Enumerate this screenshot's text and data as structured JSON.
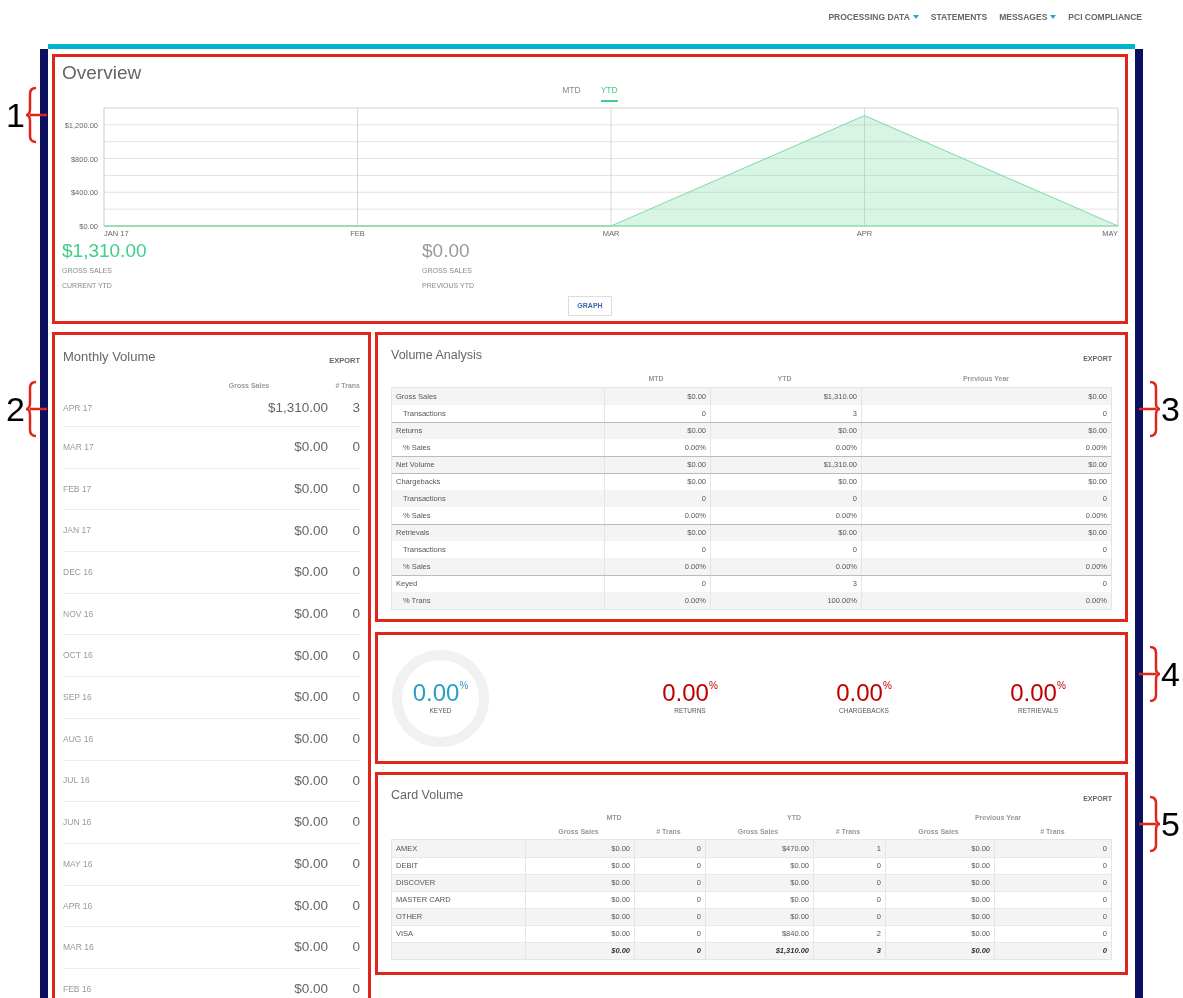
{
  "nav": [
    {
      "label": "PROCESSING DATA",
      "has_menu": true
    },
    {
      "label": "STATEMENTS",
      "has_menu": false
    },
    {
      "label": "MESSAGES",
      "has_menu": true
    },
    {
      "label": "PCI COMPLIANCE",
      "has_menu": false
    }
  ],
  "overview": {
    "title": "Overview",
    "tabs": [
      {
        "label": "MTD",
        "selected": false
      },
      {
        "label": "YTD",
        "selected": true
      }
    ],
    "chart_data": {
      "type": "area",
      "categories": [
        "JAN 17",
        "FEB",
        "MAR",
        "APR",
        "MAY"
      ],
      "series": [
        {
          "color": "#7fd9a6",
          "values": [
            0,
            0,
            0,
            1310,
            0
          ]
        }
      ],
      "grid": true,
      "ylim": [
        0,
        1400
      ],
      "yticks": [
        {
          "value": 0,
          "label": "$0.00"
        },
        {
          "value": 400,
          "label": "$400.00"
        },
        {
          "value": 800,
          "label": "$800.00"
        },
        {
          "value": 1200,
          "label": "$1,200.00"
        }
      ]
    },
    "summaries": [
      {
        "amount": "$1,310.00",
        "label": "GROSS SALES",
        "period": "CURRENT YTD",
        "color": "#3fcf86"
      },
      {
        "amount": "$0.00",
        "label": "GROSS SALES",
        "period": "PREVIOUS YTD",
        "color": "#9a9a9a"
      }
    ],
    "button": "GRAPH"
  },
  "monthly_volume": {
    "title": "Monthly Volume",
    "export": "EXPORT",
    "columns": [
      "Gross Sales",
      "# Trans"
    ],
    "rows": [
      {
        "month": "APR 17",
        "gross_sales": "$1,310.00",
        "trans": "3"
      },
      {
        "month": "MAR 17",
        "gross_sales": "$0.00",
        "trans": "0"
      },
      {
        "month": "FEB 17",
        "gross_sales": "$0.00",
        "trans": "0"
      },
      {
        "month": "JAN 17",
        "gross_sales": "$0.00",
        "trans": "0"
      },
      {
        "month": "DEC 16",
        "gross_sales": "$0.00",
        "trans": "0"
      },
      {
        "month": "NOV 16",
        "gross_sales": "$0.00",
        "trans": "0"
      },
      {
        "month": "OCT 16",
        "gross_sales": "$0.00",
        "trans": "0"
      },
      {
        "month": "SEP 16",
        "gross_sales": "$0.00",
        "trans": "0"
      },
      {
        "month": "AUG 16",
        "gross_sales": "$0.00",
        "trans": "0"
      },
      {
        "month": "JUL 16",
        "gross_sales": "$0.00",
        "trans": "0"
      },
      {
        "month": "JUN 16",
        "gross_sales": "$0.00",
        "trans": "0"
      },
      {
        "month": "MAY 16",
        "gross_sales": "$0.00",
        "trans": "0"
      },
      {
        "month": "APR 16",
        "gross_sales": "$0.00",
        "trans": "0"
      },
      {
        "month": "MAR 16",
        "gross_sales": "$0.00",
        "trans": "0"
      },
      {
        "month": "FEB 16",
        "gross_sales": "$0.00",
        "trans": "0"
      }
    ]
  },
  "volume_analysis": {
    "title": "Volume Analysis",
    "export": "EXPORT",
    "columns": [
      "MTD",
      "YTD",
      "Previous Year"
    ],
    "rows": [
      {
        "kind": "main",
        "label": "Gross Sales",
        "values": [
          "$0.00",
          "$1,310.00",
          "$0.00"
        ]
      },
      {
        "kind": "sub",
        "label": "Transactions",
        "values": [
          "0",
          "3",
          "0"
        ]
      },
      {
        "kind": "main",
        "label": "Returns",
        "values": [
          "$0.00",
          "$0.00",
          "$0.00"
        ]
      },
      {
        "kind": "sub",
        "label": "% Sales",
        "values": [
          "0.00%",
          "0.00%",
          "0.00%"
        ]
      },
      {
        "kind": "main",
        "label": "Net Volume",
        "values": [
          "$0.00",
          "$1,310.00",
          "$0.00"
        ]
      },
      {
        "kind": "main",
        "label": "Chargebacks",
        "values": [
          "$0.00",
          "$0.00",
          "$0.00"
        ]
      },
      {
        "kind": "sub",
        "label": "Transactions",
        "values": [
          "0",
          "0",
          "0"
        ]
      },
      {
        "kind": "sub",
        "label": "% Sales",
        "values": [
          "0.00%",
          "0.00%",
          "0.00%"
        ]
      },
      {
        "kind": "main",
        "label": "Retrievals",
        "values": [
          "$0.00",
          "$0.00",
          "$0.00"
        ]
      },
      {
        "kind": "sub",
        "label": "Transactions",
        "values": [
          "0",
          "0",
          "0"
        ]
      },
      {
        "kind": "sub",
        "label": "% Sales",
        "values": [
          "0.00%",
          "0.00%",
          "0.00%"
        ]
      },
      {
        "kind": "main",
        "label": "Keyed",
        "values": [
          "0",
          "3",
          "0"
        ]
      },
      {
        "kind": "sub",
        "label": "% Trans",
        "values": [
          "0.00%",
          "100.00%",
          "0.00%"
        ]
      }
    ]
  },
  "rates": [
    {
      "kind": "ring",
      "value": "0.00",
      "unit": "%",
      "label": "KEYED",
      "color": "#2a9fc4"
    },
    {
      "kind": "plain",
      "value": "0.00",
      "unit": "%",
      "label": "RETURNS",
      "color": "#c00000"
    },
    {
      "kind": "plain",
      "value": "0.00",
      "unit": "%",
      "label": "CHARGEBACKS",
      "color": "#c00000"
    },
    {
      "kind": "plain",
      "value": "0.00",
      "unit": "%",
      "label": "RETRIEVALS",
      "color": "#c00000"
    }
  ],
  "card_volume": {
    "title": "Card Volume",
    "export": "EXPORT",
    "groups": [
      "MTD",
      "YTD",
      "Previous Year"
    ],
    "subcolumns": [
      "Gross Sales",
      "# Trans",
      "Gross Sales",
      "# Trans",
      "Gross Sales",
      "# Trans"
    ],
    "rows": [
      {
        "kind": "card",
        "label": "AMEX",
        "values": [
          "$0.00",
          "0",
          "$470.00",
          "1",
          "$0.00",
          "0"
        ]
      },
      {
        "kind": "card",
        "label": "DEBIT",
        "values": [
          "$0.00",
          "0",
          "$0.00",
          "0",
          "$0.00",
          "0"
        ]
      },
      {
        "kind": "card",
        "label": "DISCOVER",
        "values": [
          "$0.00",
          "0",
          "$0.00",
          "0",
          "$0.00",
          "0"
        ]
      },
      {
        "kind": "card",
        "label": "MASTER CARD",
        "values": [
          "$0.00",
          "0",
          "$0.00",
          "0",
          "$0.00",
          "0"
        ]
      },
      {
        "kind": "card",
        "label": "OTHER",
        "values": [
          "$0.00",
          "0",
          "$0.00",
          "0",
          "$0.00",
          "0"
        ]
      },
      {
        "kind": "card",
        "label": "VISA",
        "values": [
          "$0.00",
          "0",
          "$840.00",
          "2",
          "$0.00",
          "0"
        ]
      },
      {
        "kind": "total",
        "values": [
          "$0.00",
          "0",
          "$1,310.00",
          "3",
          "$0.00",
          "0"
        ]
      }
    ]
  },
  "callouts": [
    {
      "label": "1",
      "kind": "left"
    },
    {
      "label": "2",
      "kind": "left"
    },
    {
      "label": "3",
      "kind": "right"
    },
    {
      "label": "4",
      "kind": "right"
    },
    {
      "label": "5",
      "kind": "right"
    }
  ]
}
